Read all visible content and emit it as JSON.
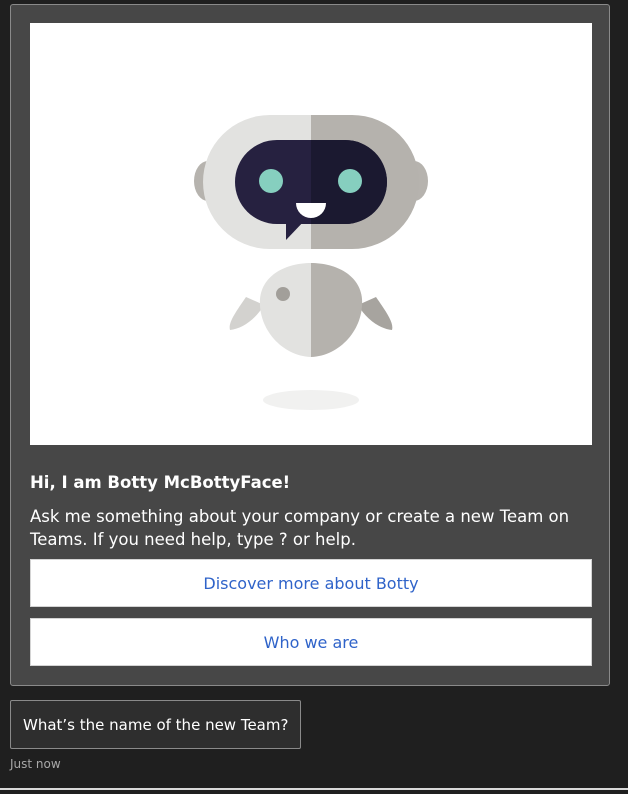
{
  "card": {
    "title": "Hi, I am Botty McBottyFace!",
    "description": "Ask me something about your company or create a new Team on Teams. If you need help, type ? or help.",
    "actions": [
      {
        "label": "Discover more about Botty"
      },
      {
        "label": "Who we are"
      }
    ]
  },
  "message": {
    "text": "What’s the name of the new Team?",
    "timestamp": "Just now"
  },
  "colors": {
    "background": "#1f1f1f",
    "card_background": "#474747",
    "action_text": "#2f63c9",
    "bot_visor": "#1c1a33",
    "bot_eyes": "#86cfbf"
  },
  "icons": {
    "hero_image": "robot-mascot-illustration"
  }
}
